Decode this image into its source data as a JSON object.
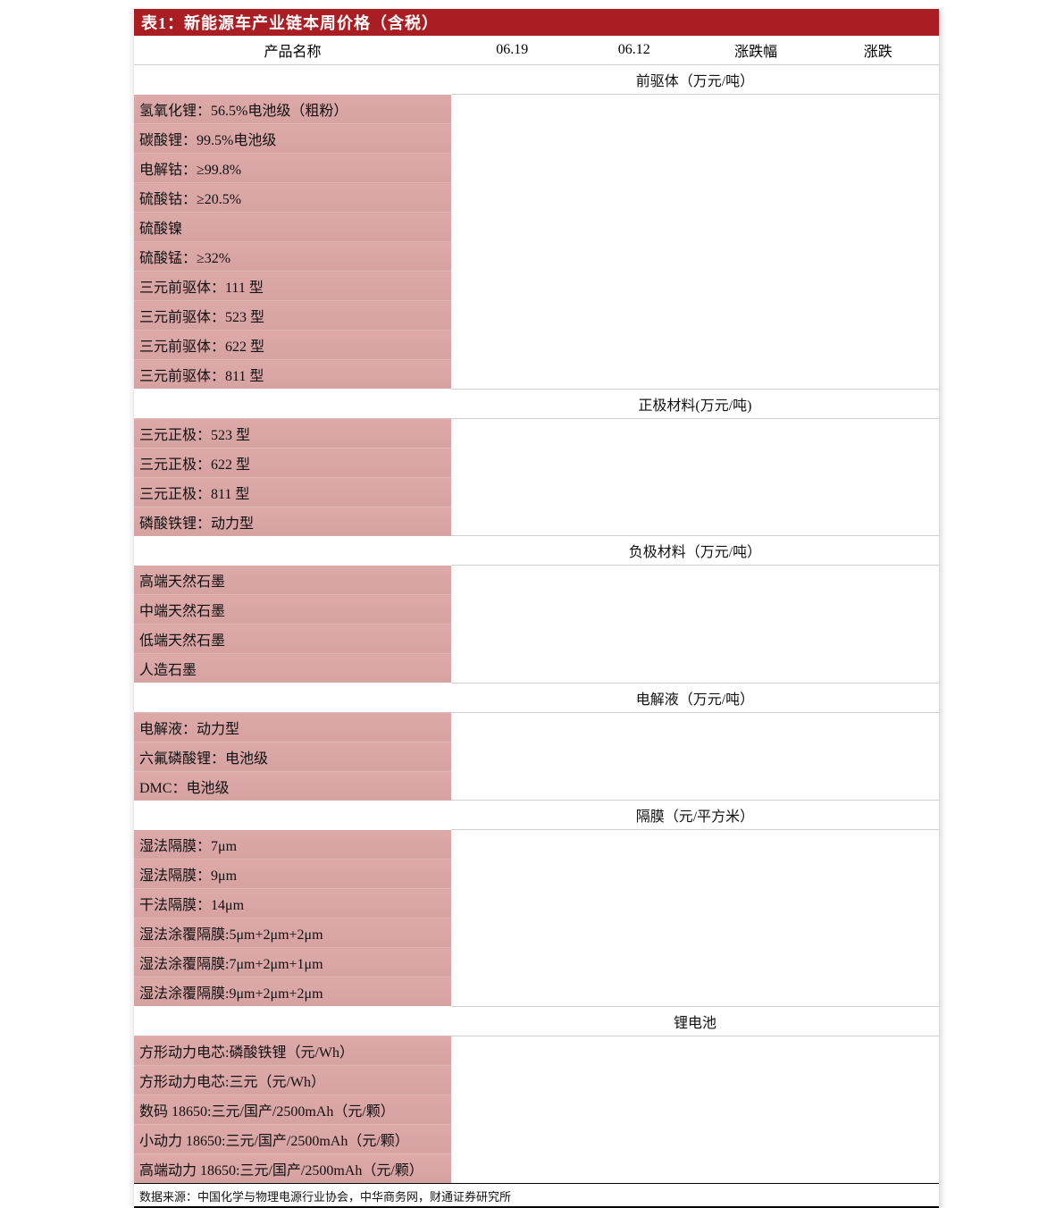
{
  "title": "表1：新能源车产业链本周价格（含税）",
  "columns": {
    "name": "产品名称",
    "c1": "06.19",
    "c2": "06.12",
    "c3": "涨跌幅",
    "c4": "涨跌"
  },
  "sections": [
    {
      "header": "前驱体（万元/吨）",
      "rows": [
        "氢氧化锂：56.5%电池级（粗粉）",
        "碳酸锂：99.5%电池级",
        "电解钴：≥99.8%",
        "硫酸钴：≥20.5%",
        "硫酸镍",
        "硫酸锰：≥32%",
        "三元前驱体：111 型",
        "三元前驱体：523 型",
        "三元前驱体：622 型",
        "三元前驱体：811 型"
      ]
    },
    {
      "header": "正极材料(万元/吨)",
      "rows": [
        "三元正极：523 型",
        "三元正极：622 型",
        "三元正极：811 型",
        "磷酸铁锂：动力型"
      ]
    },
    {
      "header": "负极材料（万元/吨）",
      "rows": [
        "高端天然石墨",
        "中端天然石墨",
        "低端天然石墨",
        "人造石墨"
      ]
    },
    {
      "header": "电解液（万元/吨）",
      "rows": [
        "电解液：动力型",
        "六氟磷酸锂：电池级",
        "DMC：电池级"
      ]
    },
    {
      "header": "隔膜（元/平方米）",
      "rows": [
        "湿法隔膜：7μm",
        "湿法隔膜：9μm",
        "干法隔膜：14μm",
        "湿法涂覆隔膜:5μm+2μm+2μm",
        "湿法涂覆隔膜:7μm+2μm+1μm",
        "湿法涂覆隔膜:9μm+2μm+2μm"
      ]
    },
    {
      "header": "锂电池",
      "rows": [
        "方形动力电芯:磷酸铁锂（元/Wh）",
        "方形动力电芯:三元（元/Wh）",
        "数码 18650:三元/国产/2500mAh（元/颗）",
        "小动力 18650:三元/国产/2500mAh（元/颗）",
        "高端动力 18650:三元/国产/2500mAh（元/颗）"
      ]
    }
  ],
  "footer": "数据来源：中国化学与物理电源行业协会，中华商务网，财通证券研究所"
}
